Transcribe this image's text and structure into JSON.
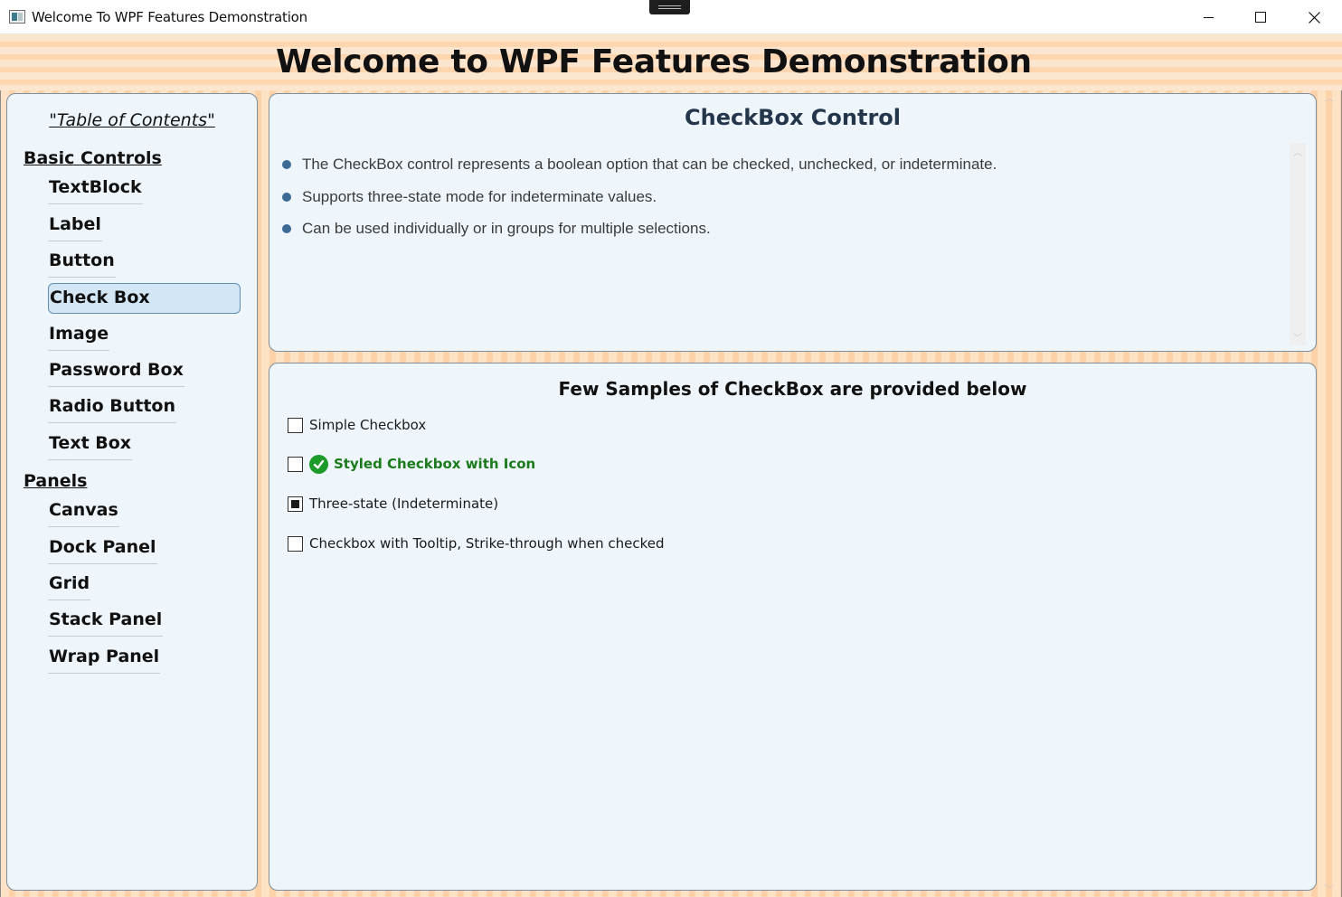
{
  "window": {
    "title": "Welcome To WPF Features Demonstration",
    "minimize_icon": "minimize-icon",
    "maximize_icon": "maximize-icon",
    "close_icon": "close-icon"
  },
  "header": {
    "heading": "Welcome to WPF Features Demonstration"
  },
  "toc": {
    "title": "\"Table of Contents\"",
    "sections": [
      {
        "label": "Basic Controls",
        "items": [
          "TextBlock",
          "Label",
          "Button",
          "Check Box",
          "Image",
          "Password Box",
          "Radio Button",
          "Text Box"
        ]
      },
      {
        "label": "Panels",
        "items": [
          "Canvas",
          "Dock Panel",
          "Grid",
          "Stack Panel",
          "Wrap Panel"
        ]
      }
    ],
    "selected": "Check Box"
  },
  "description": {
    "title": "CheckBox Control",
    "bullets": [
      "The CheckBox control represents a boolean option that can be checked, unchecked, or indeterminate.",
      "Supports three-state mode for indeterminate values.",
      "Can be used individually or in groups for multiple selections."
    ]
  },
  "samples": {
    "title": "Few Samples of CheckBox are provided below",
    "checkboxes": [
      {
        "label": "Simple Checkbox",
        "state": "unchecked"
      },
      {
        "label": "Styled Checkbox with Icon",
        "state": "unchecked",
        "icon": "check-circle-icon"
      },
      {
        "label": "Three-state (Indeterminate)",
        "state": "indeterminate"
      },
      {
        "label": "Checkbox with Tooltip, Strike-through when checked",
        "state": "unchecked"
      }
    ]
  },
  "colors": {
    "stripe_light": "#fde2c6",
    "stripe_dark": "#fed2a8",
    "panel_bg": "#eef6fc",
    "selected_bg": "#d2e6f6",
    "styled_green": "#1b7a1b",
    "bullet_blue": "#3d6a94"
  }
}
